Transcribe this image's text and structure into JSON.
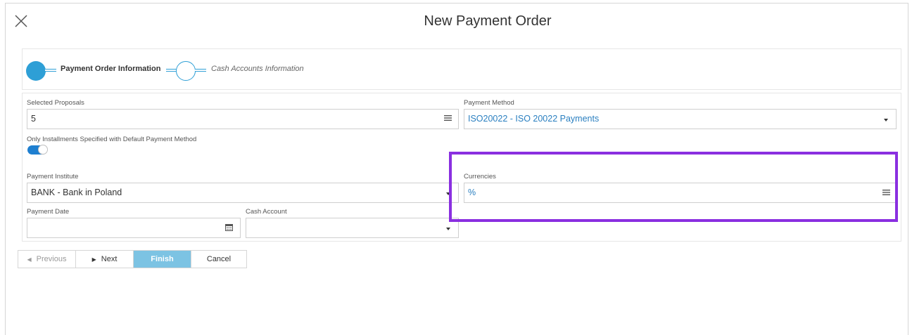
{
  "dialog": {
    "title": "New Payment Order",
    "close_icon": "close-icon"
  },
  "steps": [
    {
      "label": "Payment Order Information",
      "state": "active"
    },
    {
      "label": "Cash Accounts Information",
      "state": "pending"
    }
  ],
  "form": {
    "selected_proposals": {
      "label": "Selected Proposals",
      "value": "5",
      "icon": "list-icon"
    },
    "payment_method": {
      "label": "Payment Method",
      "value": "ISO20022 - ISO 20022 Payments"
    },
    "only_installments": {
      "label": "Only Installments Specified with Default Payment Method",
      "checked": true
    },
    "payment_institute": {
      "label": "Payment Institute",
      "value": "BANK - Bank in Poland"
    },
    "currencies": {
      "label": "Currencies",
      "value": "%",
      "icon": "list-icon"
    },
    "payment_date": {
      "label": "Payment Date",
      "value": "",
      "icon": "calendar-icon"
    },
    "cash_account": {
      "label": "Cash Account",
      "value": ""
    }
  },
  "buttons": {
    "previous": "Previous",
    "next": "Next",
    "finish": "Finish",
    "cancel": "Cancel"
  },
  "colors": {
    "accent": "#2e9fd6",
    "highlight": "#8a2fe0",
    "finish_bg": "#7cc3e3",
    "link_text": "#2a7fc0"
  }
}
